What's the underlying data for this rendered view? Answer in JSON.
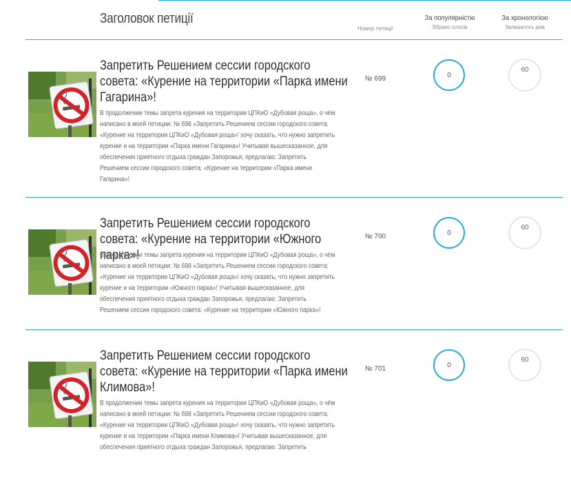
{
  "header": {
    "title": "Заголовок петиції",
    "number_label": "Номер петиції",
    "popularity_label": "За популярністю",
    "popularity_sub": "Зібрано голосів",
    "chronology_label": "За хронологією",
    "chronology_sub": "Залишилось днів"
  },
  "petitions": [
    {
      "title": "Запретить Решением сессии городского совета: «Курение на территории «Парка имени Гагарина»!",
      "description": "В продолжении темы запрета курения на территории ЦПКиО «Дубовая роща», о чём написано в моей петиции: № 698 «Запретить Решением сессии городского совета: «Курение на территории ЦПКиО «Дубовая роща»! хочу сказать, что нужно запретить курение и на территории «Парка имени Гагарина»! Учитывая вышесказанное, для обеспечения приятного отдыха граждан Запорожья, предлагаю: Запретить Решением сессии городского совета: «Курение на территории «Парка имени Гагарина»!",
      "number": "№ 699",
      "votes": "0",
      "days": "60"
    },
    {
      "title": "Запретить Решением сессии городского совета: «Курение на территории «Южного парка»!",
      "description": "В продолжении темы запрета курения на территории ЦПКиО «Дубовая роща», о чём написано в моей петиции: № 698 «Запретить Решением сессии городского совета: «Курение на территории ЦПКиО «Дубовая роща»! хочу сказать, что нужно запретить курение и на территории «Южного парка»! Учитывая вышесказанное, для обеспечения приятного отдыха граждан Запорожья, предлагаю: Запретить Решением сессии городского совета: «Курение на территории «Южного парка»!",
      "number": "№ 700",
      "votes": "0",
      "days": "60"
    },
    {
      "title": "Запретить Решением сессии городского совета: «Курение на территории «Парка имени Климова»!",
      "description": "В продолжении темы запрета курения на территории ЦПКиО «Дубовая роща», о чём написано в моей петиции: № 698 «Запретить Решением сессии городского совета: «Курение на территории ЦПКиО «Дубовая роща»! хочу сказать, что нужно запретить курение и на территории «Парка имени Климова»! Учитывая вышесказанное, для обеспечения приятного отдыха граждан Запорожья, предлагаю: Запретить",
      "number": "№ 701",
      "votes": "0",
      "days": "60"
    }
  ],
  "colors": {
    "accent": "#29a8e0",
    "circle_gray": "#e6e6e6",
    "sign_red": "#d2232a"
  },
  "icons": {
    "thumbnail": "no-smoking-sign-image"
  }
}
